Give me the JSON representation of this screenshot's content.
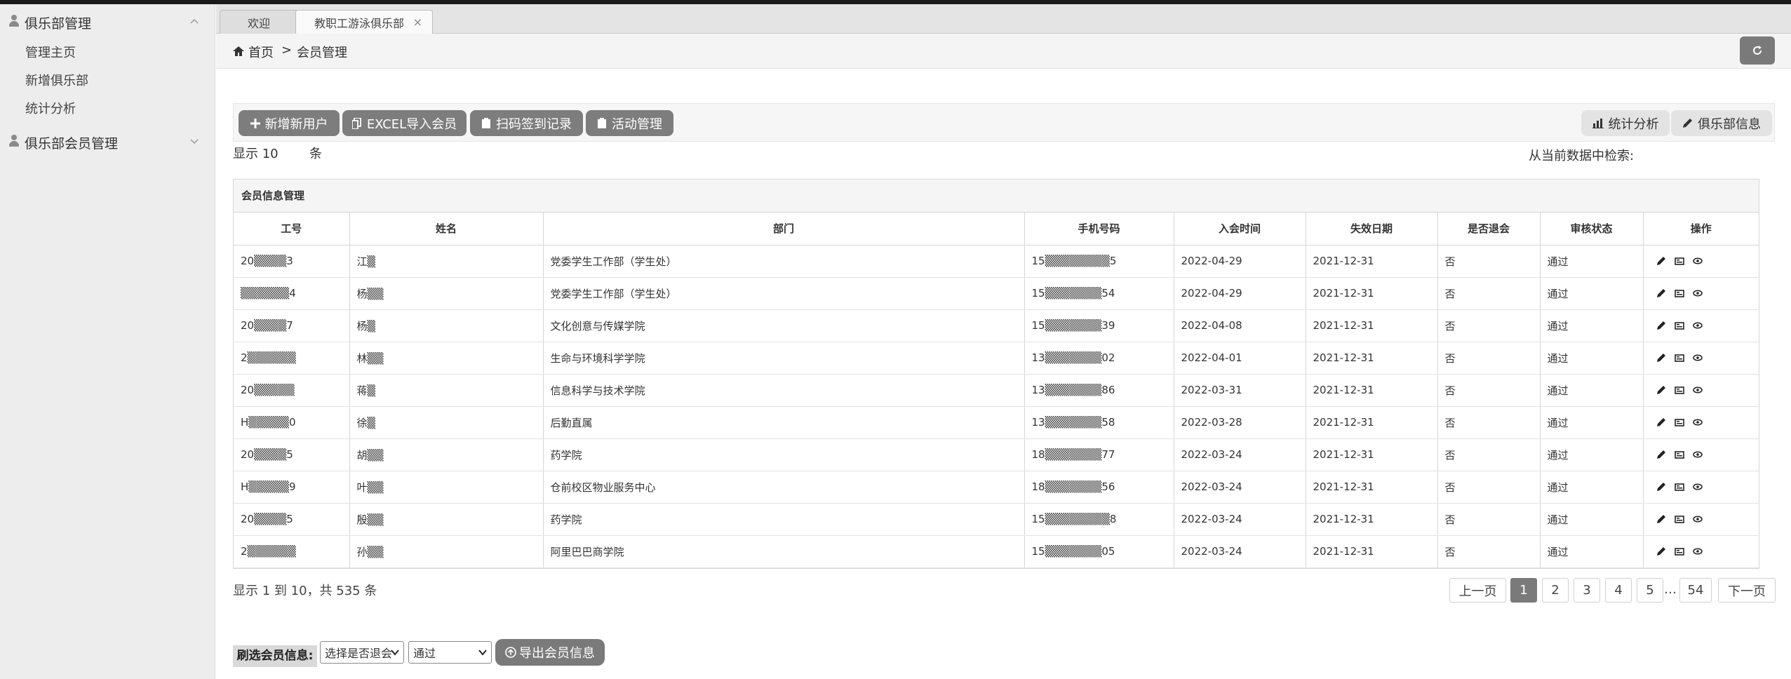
{
  "sidebar": {
    "groups": [
      {
        "label": "俱乐部管理",
        "expanded": true,
        "items": [
          "管理主页",
          "新增俱乐部",
          "统计分析"
        ]
      },
      {
        "label": "俱乐部会员管理",
        "expanded": false,
        "items": []
      }
    ]
  },
  "tabs": [
    {
      "label": "欢迎"
    },
    {
      "label": "教职工游泳俱乐部",
      "close": "×"
    }
  ],
  "breadcrumb": {
    "home": "首页",
    "separator": ">",
    "current": "会员管理"
  },
  "toolbar": {
    "add_user": "新增新用户",
    "excel_import": "EXCEL导入会员",
    "scan_record": "扫码签到记录",
    "activity": "活动管理",
    "stats": "统计分析",
    "club_info": "俱乐部信息"
  },
  "list": {
    "show_prefix": "显示 10",
    "show_unit": "条",
    "search_label": "从当前数据中检索:"
  },
  "table": {
    "title": "会员信息管理",
    "columns": [
      "工号",
      "姓名",
      "部门",
      "手机号码",
      "入会时间",
      "失效日期",
      "是否退会",
      "审核状态",
      "操作"
    ],
    "rows": [
      [
        "20▒▒▒▒3",
        "江▒",
        "党委学生工作部（学生处）",
        "15▒▒▒▒▒▒▒▒5",
        "2022-04-29",
        "2021-12-31",
        "否",
        "通过"
      ],
      [
        "▒▒▒▒▒▒4",
        "杨▒▒",
        "党委学生工作部（学生处）",
        "15▒▒▒▒▒▒▒54",
        "2022-04-29",
        "2021-12-31",
        "否",
        "通过"
      ],
      [
        "20▒▒▒▒7",
        "杨▒",
        "文化创意与传媒学院",
        "15▒▒▒▒▒▒▒39",
        "2022-04-08",
        "2021-12-31",
        "否",
        "通过"
      ],
      [
        "2▒▒▒▒▒▒",
        "林▒▒",
        "生命与环境科学学院",
        "13▒▒▒▒▒▒▒02",
        "2022-04-01",
        "2021-12-31",
        "否",
        "通过"
      ],
      [
        "20▒▒▒▒▒",
        "蒋▒",
        "信息科学与技术学院",
        "13▒▒▒▒▒▒▒86",
        "2022-03-31",
        "2021-12-31",
        "否",
        "通过"
      ],
      [
        "H▒▒▒▒▒0",
        "徐▒",
        "后勤直属",
        "13▒▒▒▒▒▒▒58",
        "2022-03-28",
        "2021-12-31",
        "否",
        "通过"
      ],
      [
        "20▒▒▒▒5",
        "胡▒▒",
        "药学院",
        "18▒▒▒▒▒▒▒77",
        "2022-03-24",
        "2021-12-31",
        "否",
        "通过"
      ],
      [
        "H▒▒▒▒▒9",
        "叶▒▒",
        "仓前校区物业服务中心",
        "18▒▒▒▒▒▒▒56",
        "2022-03-24",
        "2021-12-31",
        "否",
        "通过"
      ],
      [
        "20▒▒▒▒5",
        "殷▒▒",
        "药学院",
        "15▒▒▒▒▒▒▒▒8",
        "2022-03-24",
        "2021-12-31",
        "否",
        "通过"
      ],
      [
        "2▒▒▒▒▒▒",
        "孙▒▒",
        "阿里巴巴商学院",
        "15▒▒▒▒▒▒▒05",
        "2022-03-24",
        "2021-12-31",
        "否",
        "通过"
      ]
    ]
  },
  "summary": "显示 1 到 10，共 535 条",
  "pagination": {
    "prev": "上一页",
    "pages": [
      "1",
      "2",
      "3",
      "4",
      "5"
    ],
    "ellipsis": "…",
    "last": "54",
    "next": "下一页",
    "active": "1"
  },
  "filter": {
    "label": "刷选会员信息:",
    "quit_select": "选择是否退会",
    "status_select": "通过",
    "export": "导出会员信息"
  },
  "colors": {
    "button_gray": "#7d7d7d",
    "sidebar_bg": "#ededed"
  }
}
